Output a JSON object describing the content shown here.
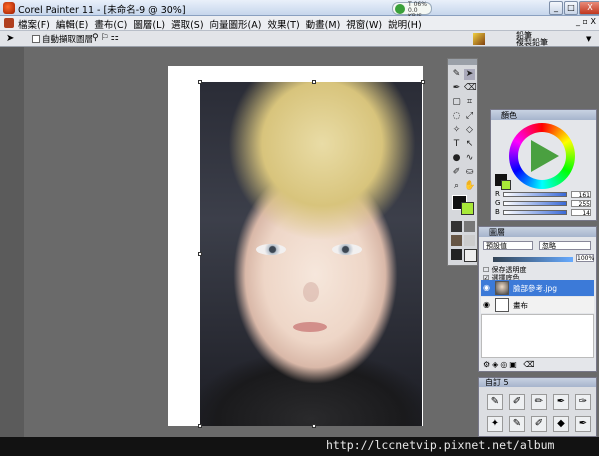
{
  "window": {
    "title": "Corel Painter 11 - [未命名-9 @ 30%]",
    "min": "_",
    "max": "□",
    "close": "X"
  },
  "tray": {
    "text": "T 06%\n0.0 KB/S"
  },
  "menu": {
    "items": [
      "檔案(F)",
      "編輯(E)",
      "畫布(C)",
      "圖層(L)",
      "選取(S)",
      "向量圖形(A)",
      "效果(T)",
      "動畫(M)",
      "視窗(W)",
      "說明(H)"
    ],
    "mini": "_ ▫ X"
  },
  "propbar": {
    "checkbox_label": "自動擷取圖層",
    "brush_line1": "鉛筆",
    "brush_line2": "複製鉛筆"
  },
  "colors": {
    "panel_title": "顏色",
    "main": "#111111",
    "secondary": "#a8e838",
    "sliders": [
      {
        "label": "R",
        "value": "161"
      },
      {
        "label": "G",
        "value": "255"
      },
      {
        "label": "B",
        "value": "14"
      }
    ]
  },
  "layers": {
    "panel_title": "圖層",
    "blend": "預設值",
    "composite": "忽略",
    "opacity": "100%",
    "chk_preserve": "保存透明度",
    "chk_pick": "選擇底色",
    "items": [
      {
        "name": "臉部參考.jpg",
        "selected": true
      },
      {
        "name": "畫布",
        "selected": false
      }
    ]
  },
  "custom": {
    "title": "自訂 5"
  },
  "watermark": "http://lccnetvip.pixnet.net/album"
}
